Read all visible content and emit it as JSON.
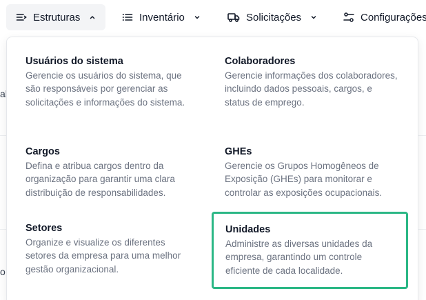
{
  "nav": {
    "items": [
      {
        "label": "Estruturas",
        "icon": "menu-lines-icon",
        "expanded": true
      },
      {
        "label": "Inventário",
        "icon": "list-icon"
      },
      {
        "label": "Solicitações",
        "icon": "truck-icon"
      },
      {
        "label": "Configurações",
        "icon": "sliders-icon"
      }
    ]
  },
  "background": {
    "fragment_1": "al",
    "fragment_2": "o"
  },
  "dropdown": {
    "items": [
      {
        "title": "Usuários do sistema",
        "description": "Gerencie os usuários do sistema, que são responsáveis por gerenciar as solicitações e informações do sistema."
      },
      {
        "title": "Colaboradores",
        "description": "Gerencie informações dos colaboradores, incluindo dados pessoais, cargos, e status de emprego."
      },
      {
        "title": "Cargos",
        "description": "Defina e atribua cargos dentro da organização para garantir uma clara distribuição de responsabilidades."
      },
      {
        "title": "GHEs",
        "description": "Gerencie os Grupos Homogêneos de Exposição (GHEs) para monitorar e controlar as exposições ocupacionais."
      },
      {
        "title": "Setores",
        "description": "Organize e visualize os diferentes setores da empresa para uma melhor gestão organizacional."
      },
      {
        "title": "Unidades",
        "description": "Administre as diversas unidades da empresa, garantindo um controle eficiente de cada localidade."
      }
    ],
    "highlight_color": "#2bb785"
  }
}
